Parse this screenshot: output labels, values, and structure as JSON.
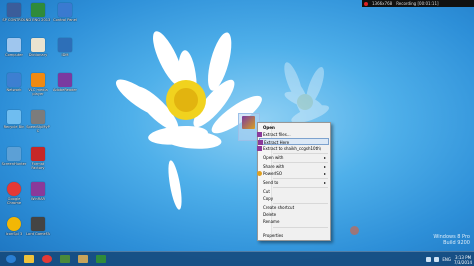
{
  "recording_bar": {
    "resolution": "1366x768",
    "status": "Recording [00:01:11]"
  },
  "desktop_icons": [
    {
      "label": "SP CONTROL",
      "icon": "sp-control-icon",
      "color": "#3b5d9a"
    },
    {
      "label": "ND ENG 2013",
      "icon": "app-icon",
      "color": "#2f8b3a"
    },
    {
      "label": "Control Panel",
      "icon": "control-panel-icon",
      "color": "#3a7ad0"
    },
    {
      "label": "Computer",
      "icon": "computer-icon",
      "color": "#9fc6ee"
    },
    {
      "label": "Dictionary",
      "icon": "book-icon",
      "color": "#e9e3d0"
    },
    {
      "label": "IDM",
      "icon": "idm-icon",
      "color": "#2d6fb8"
    },
    {
      "label": "Network",
      "icon": "network-icon",
      "color": "#3d7fd1"
    },
    {
      "label": "VLC media player",
      "icon": "vlc-icon",
      "color": "#f08a12"
    },
    {
      "label": "AdobeReader",
      "icon": "rar-icon",
      "color": "#7a3aa0"
    },
    {
      "label": "Recycle Bin",
      "icon": "recycle-bin-icon",
      "color": "#6fbdf0"
    },
    {
      "label": "SpeedUpMyPC",
      "icon": "tool-icon",
      "color": "#7c7c7c"
    },
    {
      "label": "ScreenHunter",
      "icon": "screen-icon",
      "color": "#5ca0d6"
    },
    {
      "label": "Format Factory",
      "icon": "format-factory-icon",
      "color": "#c62828"
    },
    {
      "label": "Google Chrome",
      "icon": "chrome-icon",
      "color": "#e53935"
    },
    {
      "label": "WinRAR",
      "icon": "winrar-icon",
      "color": "#8a3a9a"
    },
    {
      "label": "IconSpi 3",
      "icon": "app-icon",
      "color": "#f2b705"
    },
    {
      "label": "Lord GameFA",
      "icon": "game-icon",
      "color": "#444444"
    }
  ],
  "context_menu": {
    "items": [
      {
        "type": "item",
        "label": "Open",
        "bold": true
      },
      {
        "type": "item",
        "label": "Extract files...",
        "icon": "winrar-icon"
      },
      {
        "type": "item",
        "label": "Extract Here",
        "icon": "winrar-icon",
        "highlighted": true
      },
      {
        "type": "item",
        "label": "Extract to shaikh_ccgsh10th\\",
        "icon": "winrar-icon"
      },
      {
        "type": "separator"
      },
      {
        "type": "item",
        "label": "Open with",
        "submenu": true
      },
      {
        "type": "separator"
      },
      {
        "type": "item",
        "label": "Share with",
        "submenu": true
      },
      {
        "type": "item",
        "label": "PowerISO",
        "icon": "poweriso-icon",
        "submenu": true
      },
      {
        "type": "separator"
      },
      {
        "type": "item",
        "label": "Send to",
        "submenu": true
      },
      {
        "type": "separator"
      },
      {
        "type": "item",
        "label": "Cut"
      },
      {
        "type": "item",
        "label": "Copy"
      },
      {
        "type": "separator"
      },
      {
        "type": "item",
        "label": "Create shortcut"
      },
      {
        "type": "item",
        "label": "Delete"
      },
      {
        "type": "item",
        "label": "Rename"
      },
      {
        "type": "separator"
      },
      {
        "type": "item",
        "label": "Properties"
      }
    ]
  },
  "watermark": {
    "line1": "Windows 8 Pro",
    "line2": "Build 9200"
  },
  "taskbar": {
    "clock_time": "3:13 PM",
    "clock_date": "7/3/2014",
    "language": "ENG",
    "buttons": [
      {
        "icon": "ie-icon",
        "color": "#2a7fd4"
      },
      {
        "icon": "folder-icon",
        "color": "#f0c23a"
      },
      {
        "icon": "chrome-icon",
        "color": "#e53935"
      },
      {
        "icon": "app-icon",
        "color": "#4a8a3a"
      },
      {
        "icon": "app-icon",
        "color": "#c8a45a"
      },
      {
        "icon": "app-icon",
        "color": "#2f8b3a"
      }
    ]
  },
  "colors": {
    "menu_highlight": "#dbe8f6",
    "taskbar": "#144678"
  }
}
